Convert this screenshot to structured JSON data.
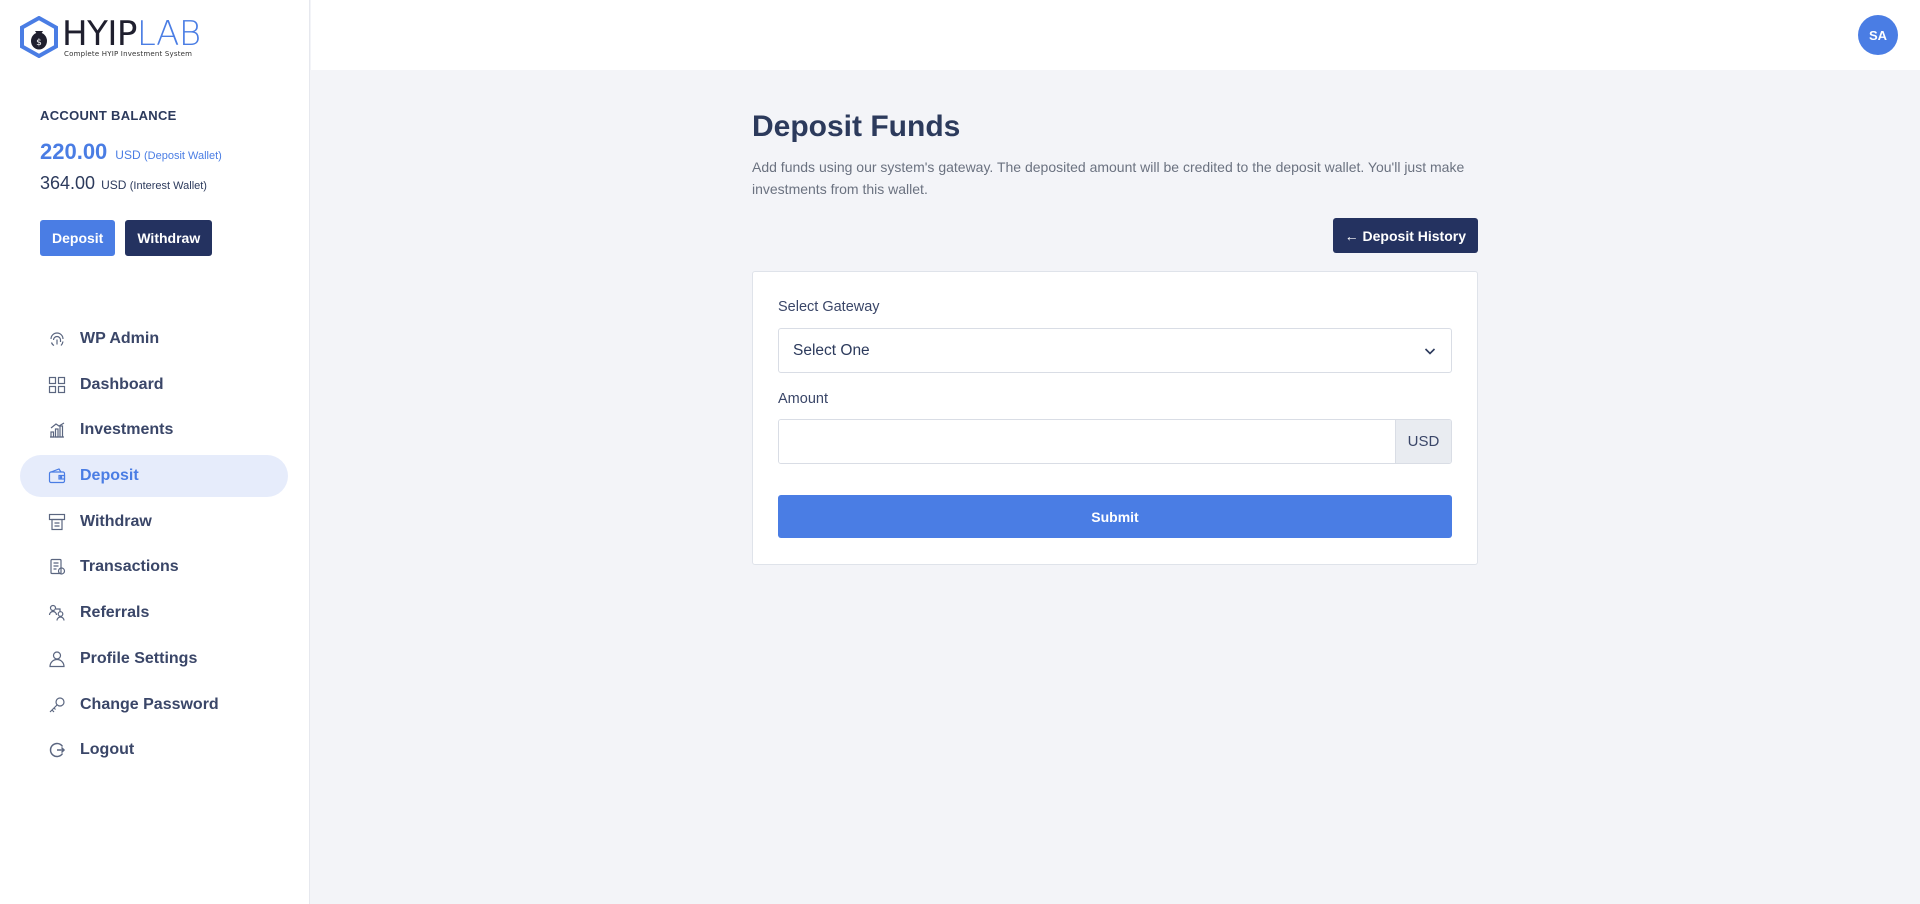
{
  "brand": {
    "name_part1": "HYIP",
    "name_part2": "LAB",
    "tagline": "Complete HYIP Investment System",
    "accent": "#4a7de4",
    "navy": "#243260"
  },
  "balance": {
    "title": "ACCOUNT BALANCE",
    "deposit_amount": "220.00",
    "deposit_currency": "USD",
    "deposit_wallet_label": "(Deposit Wallet)",
    "interest_amount": "364.00",
    "interest_currency": "USD",
    "interest_wallet_label": "(Interest Wallet)",
    "deposit_button": "Deposit",
    "withdraw_button": "Withdraw"
  },
  "menu": {
    "items": [
      {
        "label": "WP Admin",
        "icon": "fingerprint-icon"
      },
      {
        "label": "Dashboard",
        "icon": "dashboard-grid-icon"
      },
      {
        "label": "Investments",
        "icon": "investments-chart-icon"
      },
      {
        "label": "Deposit",
        "icon": "wallet-icon",
        "active": true
      },
      {
        "label": "Withdraw",
        "icon": "atm-icon"
      },
      {
        "label": "Transactions",
        "icon": "transactions-icon"
      },
      {
        "label": "Referrals",
        "icon": "referrals-icon"
      },
      {
        "label": "Profile Settings",
        "icon": "user-icon"
      },
      {
        "label": "Change Password",
        "icon": "key-icon"
      },
      {
        "label": "Logout",
        "icon": "logout-icon"
      }
    ]
  },
  "topbar": {
    "avatar_initials": "SA"
  },
  "main": {
    "title": "Deposit Funds",
    "description": "Add funds using our system's gateway. The deposited amount will be credited to the deposit wallet. You'll just make investments from this wallet.",
    "history_button": "← Deposit History",
    "form": {
      "gateway_label": "Select Gateway",
      "gateway_selected": "Select One",
      "amount_label": "Amount",
      "amount_value": "",
      "amount_currency": "USD",
      "submit_label": "Submit"
    }
  }
}
